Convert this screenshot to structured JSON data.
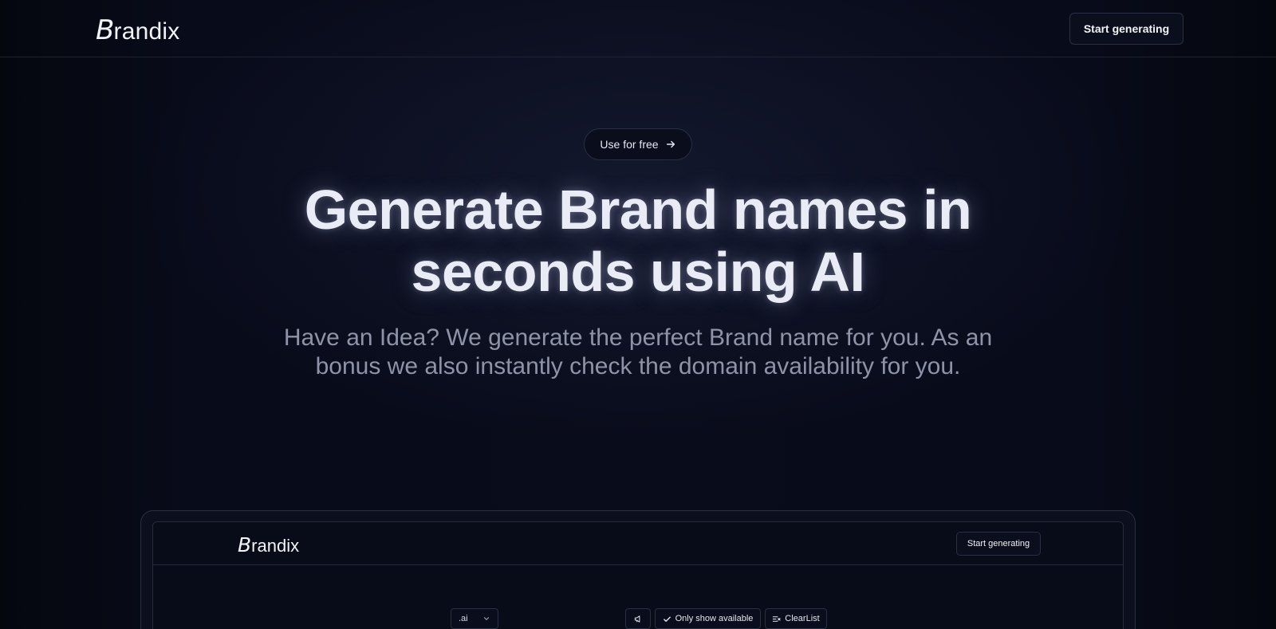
{
  "header": {
    "logo_mark": "B",
    "logo_rest": "randix",
    "cta_label": "Start generating"
  },
  "hero": {
    "pill_label": "Use for free",
    "title_line1": "Generate Brand names in",
    "title_line2": "seconds using AI",
    "subtitle_line1": "Have an Idea? We generate the perfect Brand name for you. As an",
    "subtitle_line2": "bonus we also instantly check the domain availability for you."
  },
  "preview": {
    "logo_mark": "B",
    "logo_rest": "randix",
    "cta_label": "Start generating",
    "tld_selected": ".ai",
    "toolbar": {
      "available_label": "Only show available",
      "clear_label": "ClearList"
    }
  },
  "icons": {
    "pill": "arrow-right-icon",
    "tld": "chevron-down-icon",
    "tool1": "megaphone-icon",
    "available": "check-icon",
    "clear": "clear-list-icon"
  }
}
